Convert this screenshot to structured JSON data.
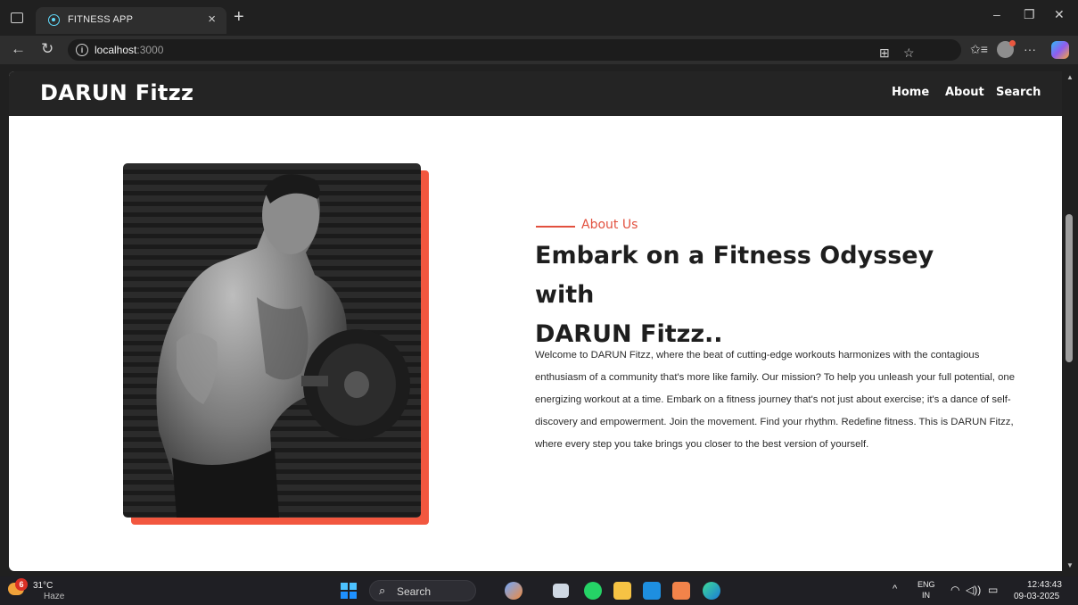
{
  "browser": {
    "tab_title": "FITNESS APP",
    "tab_close": "×",
    "new_tab": "+",
    "url_host": "localhost",
    "url_port": ":3000",
    "info": "i",
    "min": "–",
    "restore": "❐",
    "close": "✕",
    "back": "←",
    "reload": "↻",
    "split": "⊞",
    "star": "☆",
    "favorites": "✩≡",
    "more": "···"
  },
  "site": {
    "brand": "DARUN Fitzz",
    "nav": [
      "Home",
      "About",
      "Search"
    ]
  },
  "about": {
    "label": "About Us",
    "heading_line1": "Embark on a Fitness Odyssey with",
    "heading_line2": "DARUN Fitzz..",
    "paragraph": "Welcome to DARUN Fitzz, where the beat of cutting-edge workouts harmonizes with the contagious enthusiasm of a community that's more like family. Our mission? To help you unleash your full potential, one energizing workout at a time. Embark on a fitness journey that's not just about exercise; it's a dance of self-discovery and empowerment. Join the movement. Find your rhythm. Redefine fitness. This is DARUN Fitzz, where every step you take brings you closer to the best version of yourself."
  },
  "colors": {
    "accent": "#e2503e",
    "nav_bg": "#242424"
  },
  "taskbar": {
    "weather_badge": "6",
    "weather_temp": "31°C",
    "weather_desc": "Haze",
    "search_placeholder": "Search",
    "search_glyph": "⌕",
    "tray_up": "^",
    "lang_top": "ENG",
    "lang_bottom": "IN",
    "wifi": "◠",
    "volume": "◁))",
    "battery": "▭",
    "time": "12:43:43",
    "date": "09-03-2025"
  }
}
